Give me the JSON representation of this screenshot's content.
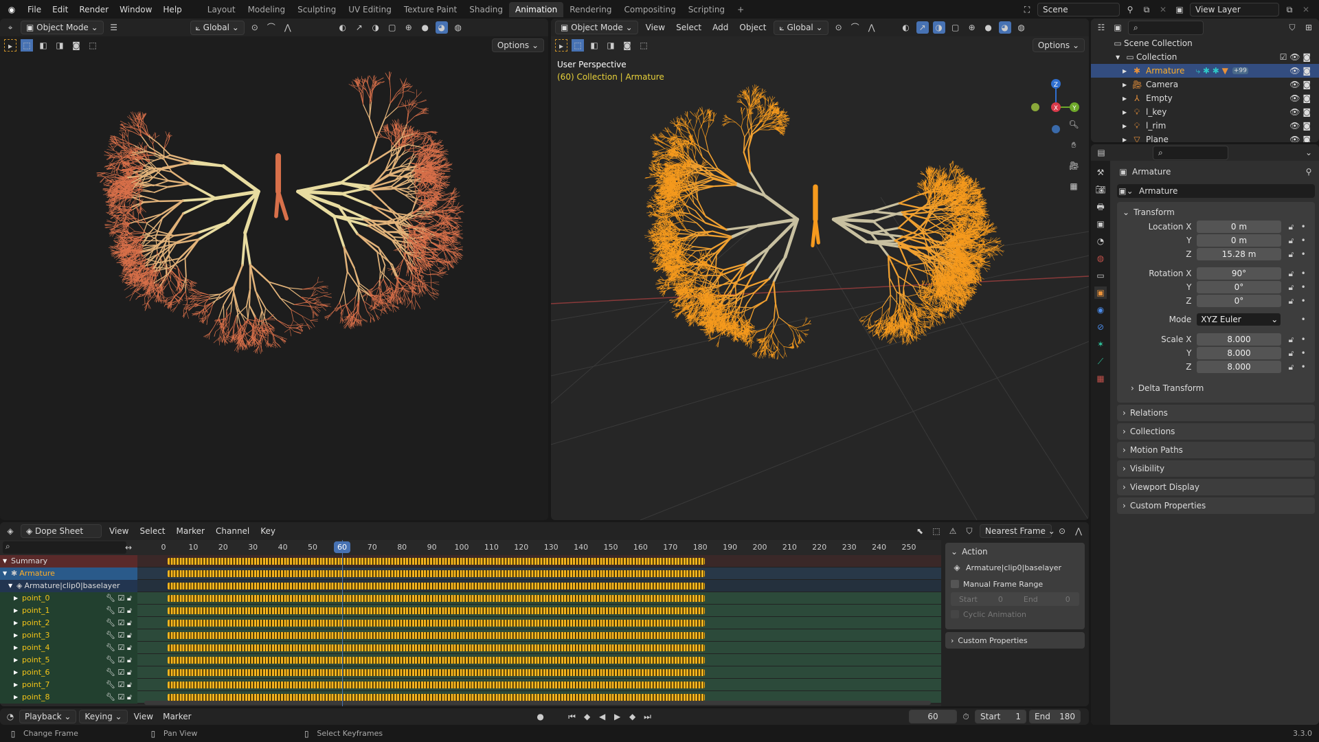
{
  "topbar": {
    "menus": [
      "File",
      "Edit",
      "Render",
      "Window",
      "Help"
    ],
    "workspaces": [
      "Layout",
      "Modeling",
      "Sculpting",
      "UV Editing",
      "Texture Paint",
      "Shading",
      "Animation",
      "Rendering",
      "Compositing",
      "Scripting"
    ],
    "active_workspace": "Animation",
    "add": "+",
    "scene": "Scene",
    "view_layer": "View Layer"
  },
  "viewport_left": {
    "mode": "Object Mode",
    "orientation": "Global",
    "options": "Options"
  },
  "viewport_right": {
    "mode": "Object Mode",
    "menus": [
      "View",
      "Select",
      "Add",
      "Object"
    ],
    "orientation": "Global",
    "options": "Options",
    "overlay_title": "User Perspective",
    "overlay_sub": "(60) Collection | Armature",
    "gizmo": {
      "x": "X",
      "y": "Y",
      "z": "Z"
    }
  },
  "outliner": {
    "scene_collection": "Scene Collection",
    "collection": "Collection",
    "items": [
      {
        "name": "Armature",
        "selected": true,
        "badge": "+99"
      },
      {
        "name": "Camera"
      },
      {
        "name": "Empty"
      },
      {
        "name": "l_key"
      },
      {
        "name": "l_rim"
      },
      {
        "name": "Plane"
      }
    ]
  },
  "properties": {
    "object_name": "Armature",
    "datablock": "Armature",
    "transform_title": "Transform",
    "location": {
      "label": "Location X",
      "x": "0 m",
      "y": "0 m",
      "z": "15.28 m"
    },
    "rotation": {
      "label": "Rotation X",
      "x": "90°",
      "y": "0°",
      "z": "0°"
    },
    "mode_label": "Mode",
    "mode": "XYZ Euler",
    "scale": {
      "label": "Scale X",
      "x": "8.000",
      "y": "8.000",
      "z": "8.000"
    },
    "axis_y": "Y",
    "axis_z": "Z",
    "delta": "Delta Transform",
    "panels": [
      "Relations",
      "Collections",
      "Motion Paths",
      "Visibility",
      "Viewport Display",
      "Custom Properties"
    ]
  },
  "dopesheet": {
    "editor": "Dope Sheet",
    "menus": [
      "View",
      "Select",
      "Marker",
      "Channel",
      "Key"
    ],
    "snap": "Nearest Frame",
    "current_frame": "60",
    "ticks": [
      "0",
      "10",
      "20",
      "30",
      "40",
      "50",
      "60",
      "70",
      "80",
      "90",
      "100",
      "110",
      "120",
      "130",
      "140",
      "150",
      "160",
      "170",
      "180",
      "190",
      "200",
      "210",
      "220",
      "230",
      "240",
      "250"
    ],
    "summary": "Summary",
    "object": "Armature",
    "action": "Armature|clip0|baselayer",
    "channels": [
      "point_0",
      "point_1",
      "point_2",
      "point_3",
      "point_4",
      "point_5",
      "point_6",
      "point_7",
      "point_8"
    ]
  },
  "action_panel": {
    "title": "Action",
    "action": "Armature|clip0|baselayer",
    "manual": "Manual Frame Range",
    "start_label": "Start",
    "start": "0",
    "end_label": "End",
    "end": "0",
    "cyclic": "Cyclic Animation",
    "custom": "Custom Properties"
  },
  "timeline": {
    "menus": [
      "Playback",
      "Keying",
      "View",
      "Marker"
    ],
    "frame": "60",
    "start_label": "Start",
    "start": "1",
    "end_label": "End",
    "end": "180"
  },
  "statusbar": {
    "hints": [
      "Change Frame",
      "Pan View",
      "Select Keyframes"
    ],
    "version": "3.3.0"
  }
}
